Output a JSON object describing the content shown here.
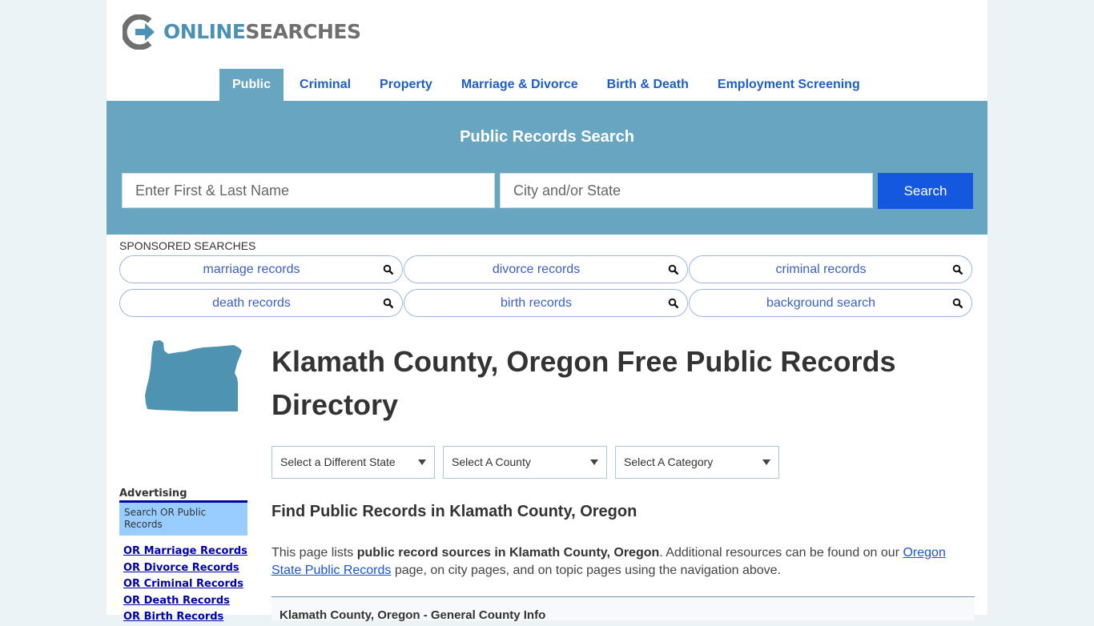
{
  "brand": {
    "name_part1": "ONLINE",
    "name_part2": "SEARCHES",
    "colors": {
      "primary": "#4b91b5",
      "gray": "#6f6f6f"
    }
  },
  "nav": {
    "items": [
      {
        "label": "Public",
        "active": true
      },
      {
        "label": "Criminal",
        "active": false
      },
      {
        "label": "Property",
        "active": false
      },
      {
        "label": "Marriage & Divorce",
        "active": false
      },
      {
        "label": "Birth & Death",
        "active": false
      },
      {
        "label": "Employment Screening",
        "active": false
      }
    ]
  },
  "search": {
    "title": "Public Records Search",
    "name_placeholder": "Enter First & Last Name",
    "name_value": "",
    "location_placeholder": "City and/or State",
    "location_value": "",
    "button_label": "Search",
    "band_color": "#68a5c0",
    "button_color": "#1558e0"
  },
  "sponsored": {
    "label": "SPONSORED SEARCHES",
    "items": [
      {
        "label": "marriage records",
        "icon": "search-icon"
      },
      {
        "label": "divorce records",
        "icon": "search-icon"
      },
      {
        "label": "criminal records",
        "icon": "search-icon"
      },
      {
        "label": "death records",
        "icon": "search-icon"
      },
      {
        "label": "birth records",
        "icon": "search-icon"
      },
      {
        "label": "background search",
        "icon": "search-icon"
      }
    ]
  },
  "page": {
    "title": "Klamath County, Oregon Free Public Records Directory",
    "state_map_icon": "oregon-state-map"
  },
  "filters": {
    "state": {
      "selected": "Select a Different State"
    },
    "county": {
      "selected": "Select A County"
    },
    "category": {
      "selected": "Select A Category"
    }
  },
  "sidebar": {
    "advertising_label": "Advertising",
    "box_title": "Search OR Public Records",
    "links": [
      "OR Marriage Records",
      "OR Divorce Records",
      "OR Criminal Records",
      "OR Death Records",
      "OR Birth Records"
    ]
  },
  "main": {
    "heading": "Find Public Records in Klamath County, Oregon",
    "intro": {
      "prefix": "This page lists ",
      "bold": "public record sources in Klamath County, Oregon",
      "middle": ". Additional resources can be found on our ",
      "link": "Oregon State Public Records",
      "suffix": " page, on city pages, and on topic pages using the navigation above."
    },
    "info_box_title": "Klamath County, Oregon - General County Info"
  }
}
